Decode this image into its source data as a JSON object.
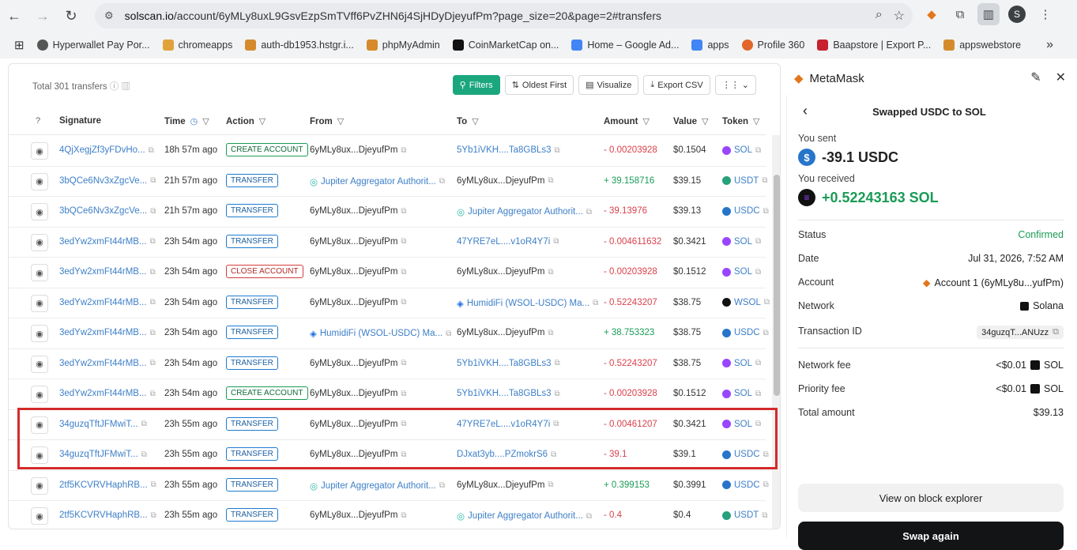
{
  "browser": {
    "url_host": "solscan.io",
    "url_path": "/account/6yMLy8uxL9GsvEzpSmTVff6PvZHN6j4SjHDyDjeyufPm?page_size=20&page=2#transfers",
    "profile_initial": "S"
  },
  "bookmarks": [
    {
      "label": "Hyperwallet Pay Por...",
      "color": "#555555"
    },
    {
      "label": "chromeapps",
      "color": "#e2a23b"
    },
    {
      "label": "auth-db1953.hstgr.i...",
      "color": "#d58b2c"
    },
    {
      "label": "phpMyAdmin",
      "color": "#d58b2c"
    },
    {
      "label": "CoinMarketCap on...",
      "color": "#111111"
    },
    {
      "label": "Home – Google Ad...",
      "color": "#4285f4"
    },
    {
      "label": "apps",
      "color": "#4285f4"
    },
    {
      "label": "Profile 360",
      "color": "#e0662a"
    },
    {
      "label": "Baapstore | Export P...",
      "color": "#c8202f"
    },
    {
      "label": "appswebstore",
      "color": "#d58b2c"
    }
  ],
  "table": {
    "total": "Total 301 transfers",
    "buttons": {
      "filters": "Filters",
      "oldest": "Oldest First",
      "visualize": "Visualize",
      "export": "Export CSV"
    },
    "headers": {
      "signature": "Signature",
      "time": "Time",
      "action": "Action",
      "from": "From",
      "to": "To",
      "amount": "Amount",
      "value": "Value",
      "token": "Token"
    },
    "rows": [
      {
        "sig": "4QjXegjZf3yFDvHo...",
        "time": "18h 57m ago",
        "action": "CREATE ACCOUNT",
        "from": "6yMLy8ux...DjeyufPm",
        "to": "5Yb1iVKH....Ta8GBLs3",
        "amount": "- 0.00203928",
        "value": "$0.1504",
        "token": "SOL"
      },
      {
        "sig": "3bQCe6Nv3xZgcVe...",
        "time": "21h 57m ago",
        "action": "TRANSFER",
        "from": "Jupiter Aggregator Authorit...",
        "to": "6yMLy8ux...DjeyufPm",
        "amount": "+ 39.158716",
        "value": "$39.15",
        "token": "USDT"
      },
      {
        "sig": "3bQCe6Nv3xZgcVe...",
        "time": "21h 57m ago",
        "action": "TRANSFER",
        "from": "6yMLy8ux...DjeyufPm",
        "to": "Jupiter Aggregator Authorit...",
        "amount": "- 39.13976",
        "value": "$39.13",
        "token": "USDC"
      },
      {
        "sig": "3edYw2xmFt44rMB...",
        "time": "23h 54m ago",
        "action": "TRANSFER",
        "from": "6yMLy8ux...DjeyufPm",
        "to": "47YRE7eL....v1oR4Y7i",
        "amount": "- 0.004611632",
        "value": "$0.3421",
        "token": "SOL"
      },
      {
        "sig": "3edYw2xmFt44rMB...",
        "time": "23h 54m ago",
        "action": "CLOSE ACCOUNT",
        "from": "6yMLy8ux...DjeyufPm",
        "to": "6yMLy8ux...DjeyufPm",
        "amount": "- 0.00203928",
        "value": "$0.1512",
        "token": "SOL"
      },
      {
        "sig": "3edYw2xmFt44rMB...",
        "time": "23h 54m ago",
        "action": "TRANSFER",
        "from": "6yMLy8ux...DjeyufPm",
        "to": "HumidiFi (WSOL-USDC) Ma...",
        "amount": "- 0.52243207",
        "value": "$38.75",
        "token": "WSOL"
      },
      {
        "sig": "3edYw2xmFt44rMB...",
        "time": "23h 54m ago",
        "action": "TRANSFER",
        "from": "HumidiFi (WSOL-USDC) Ma...",
        "to": "6yMLy8ux...DjeyufPm",
        "amount": "+ 38.753323",
        "value": "$38.75",
        "token": "USDC"
      },
      {
        "sig": "3edYw2xmFt44rMB...",
        "time": "23h 54m ago",
        "action": "TRANSFER",
        "from": "6yMLy8ux...DjeyufPm",
        "to": "5Yb1iVKH....Ta8GBLs3",
        "amount": "- 0.52243207",
        "value": "$38.75",
        "token": "SOL"
      },
      {
        "sig": "3edYw2xmFt44rMB...",
        "time": "23h 54m ago",
        "action": "CREATE ACCOUNT",
        "from": "6yMLy8ux...DjeyufPm",
        "to": "5Yb1iVKH....Ta8GBLs3",
        "amount": "- 0.00203928",
        "value": "$0.1512",
        "token": "SOL"
      },
      {
        "sig": "34guzqTftJFMwiT...",
        "time": "23h 55m ago",
        "action": "TRANSFER",
        "from": "6yMLy8ux...DjeyufPm",
        "to": "47YRE7eL....v1oR4Y7i",
        "amount": "- 0.00461207",
        "value": "$0.3421",
        "token": "SOL"
      },
      {
        "sig": "34guzqTftJFMwiT...",
        "time": "23h 55m ago",
        "action": "TRANSFER",
        "from": "6yMLy8ux...DjeyufPm",
        "to": "DJxat3yb....PZmokrS6",
        "amount": "- 39.1",
        "value": "$39.1",
        "token": "USDC"
      },
      {
        "sig": "2tf5KCVRVHaphRB...",
        "time": "23h 55m ago",
        "action": "TRANSFER",
        "from": "Jupiter Aggregator Authorit...",
        "to": "6yMLy8ux...DjeyufPm",
        "amount": "+ 0.399153",
        "value": "$0.3991",
        "token": "USDC"
      },
      {
        "sig": "2tf5KCVRVHaphRB...",
        "time": "23h 55m ago",
        "action": "TRANSFER",
        "from": "6yMLy8ux...DjeyufPm",
        "to": "Jupiter Aggregator Authorit...",
        "amount": "- 0.4",
        "value": "$0.4",
        "token": "USDT"
      }
    ]
  },
  "metamask": {
    "title": "MetaMask",
    "header": "Swapped USDC to SOL",
    "sent_label": "You sent",
    "sent_amount": "-39.1 USDC",
    "received_label": "You received",
    "received_amount": "+0.52243163 SOL",
    "status_label": "Status",
    "status": "Confirmed",
    "date_label": "Date",
    "date": "Jul 31, 2026, 7:52 AM",
    "account_label": "Account",
    "account": "Account 1 (6yMLy8u...yufPm)",
    "network_label": "Network",
    "network": "Solana",
    "txid_label": "Transaction ID",
    "txid": "34guzqT...ANUzz",
    "netfee_label": "Network fee",
    "netfee": "<$0.01",
    "prifee_label": "Priority fee",
    "prifee": "<$0.01",
    "fee_unit": "SOL",
    "total_label": "Total amount",
    "total": "$39.13",
    "explorer_btn": "View on block explorer",
    "swap_btn": "Swap again",
    "colors": {
      "confirmed": "#1a9b56",
      "received": "#1a9b56"
    }
  }
}
